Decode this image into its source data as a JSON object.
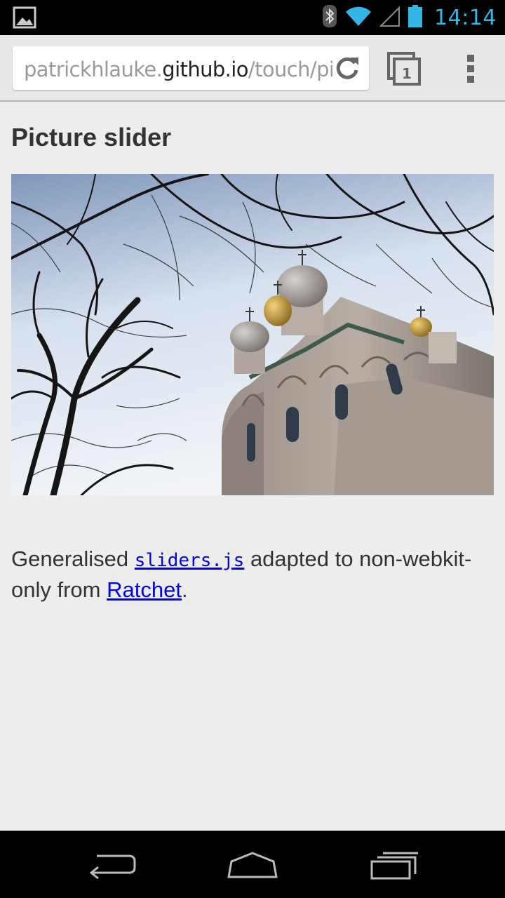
{
  "status_bar": {
    "time": "14:14",
    "icons": [
      "image-notification-icon",
      "bluetooth-icon",
      "wifi-icon",
      "signal-icon",
      "battery-icon"
    ],
    "accent_color": "#33b5e5"
  },
  "browser": {
    "url_prefix": "patrickhlauke.",
    "url_host": "github.io",
    "url_path": "/touch/pi",
    "tab_count": "1"
  },
  "page": {
    "title": "Picture slider",
    "description": {
      "text_before": "Generalised ",
      "code_link": "sliders.js",
      "text_middle": " adapted to non-webkit-only from ",
      "link": "Ratchet",
      "text_after": "."
    },
    "link_color": "#0000ee"
  },
  "nav_bar": {
    "icons": [
      "back-icon",
      "home-icon",
      "recent-apps-icon"
    ]
  }
}
